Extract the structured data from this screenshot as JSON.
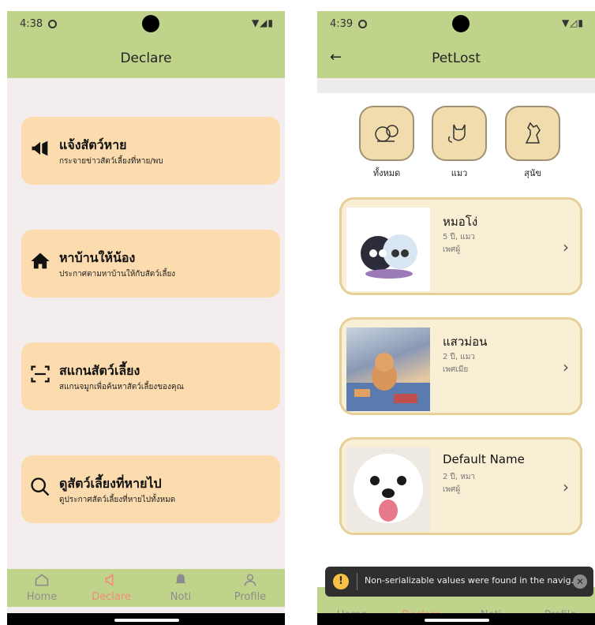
{
  "left_screen": {
    "status": {
      "time": "4:38",
      "icons": "▼◢▮"
    },
    "title": "Declare",
    "menu": [
      {
        "title": "แจ้งสัตว์หาย",
        "subtitle": "กระจายข่าวสัตว์เลี้ยงที่หาย/พบ",
        "icon": "megaphone-icon"
      },
      {
        "title": "หาบ้านให้น้อง",
        "subtitle": "ประกาศตามหาบ้านให้กับสัตว์เลี้ยง",
        "icon": "home-icon"
      },
      {
        "title": "สแกนสัตว์เลี้ยง",
        "subtitle": "สแกนจมูกเพื่อค้นหาสัตว์เลี้ยงของคุณ",
        "icon": "scan-icon"
      },
      {
        "title": "ดูสัตว์เลี้ยงที่หายไป",
        "subtitle": "ดูประกาศสัตว์เลี้ยงที่หายไปทั้งหมด",
        "icon": "search-icon"
      }
    ],
    "nav": {
      "home": "Home",
      "declare": "Declare",
      "noti": "Noti",
      "profile": "Profile",
      "active": "Declare"
    }
  },
  "right_screen": {
    "status": {
      "time": "4:39",
      "icons": "▼◿▮"
    },
    "title": "PetLost",
    "filters": [
      {
        "label": "ทั้งหมด",
        "icon": "all-pets-icon"
      },
      {
        "label": "แมว",
        "icon": "cat-icon"
      },
      {
        "label": "สุนัข",
        "icon": "dog-icon"
      }
    ],
    "pets": [
      {
        "name": "หมอโง่",
        "age_type": "5 ปี, แมว",
        "sex": "เพศผู้"
      },
      {
        "name": "แสวม่อน",
        "age_type": "2 ปี, แมว",
        "sex": "เพศเมีย"
      },
      {
        "name": "Default Name",
        "age_type": "2 ปี, หมา",
        "sex": "เพศผู้"
      }
    ],
    "toast": "Non-serializable values were found in the navig...",
    "nav": {
      "home": "Home",
      "declare": "Declare",
      "noti": "Noti",
      "profile": "Profile",
      "active": "Declare"
    }
  }
}
